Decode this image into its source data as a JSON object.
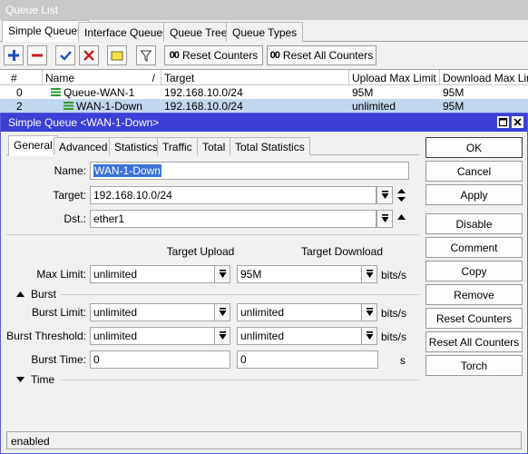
{
  "window": {
    "title": "Queue List"
  },
  "tabs": [
    "Simple Queues",
    "Interface Queues",
    "Queue Tree",
    "Queue Types"
  ],
  "toolbar": {
    "reset_counters": "Reset Counters",
    "reset_all_counters": "Reset All Counters"
  },
  "grid": {
    "headers": [
      "#",
      "Name",
      "Target",
      "Upload Max Limit",
      "Download Max Limit"
    ],
    "rows": [
      {
        "num": "0",
        "name": "Queue-WAN-1",
        "target": "192.168.10.0/24",
        "upload": "95M",
        "download": "95M"
      },
      {
        "num": "2",
        "name": "WAN-1-Down",
        "target": "192.168.10.0/24",
        "upload": "unlimited",
        "download": "95M"
      }
    ]
  },
  "dialog": {
    "title": "Simple Queue <WAN-1-Down>",
    "tabs": [
      "General",
      "Advanced",
      "Statistics",
      "Traffic",
      "Total",
      "Total Statistics"
    ],
    "labels": {
      "name": "Name:",
      "target": "Target:",
      "dst": "Dst.:",
      "target_upload": "Target Upload",
      "target_download": "Target Download",
      "max_limit": "Max Limit:",
      "burst": "Burst",
      "burst_limit": "Burst Limit:",
      "burst_threshold": "Burst Threshold:",
      "burst_time": "Burst Time:",
      "time": "Time"
    },
    "values": {
      "name": "WAN-1-Down",
      "target": "192.168.10.0/24",
      "dst": "ether1",
      "max_up": "unlimited",
      "max_down": "95M",
      "burst_limit_up": "unlimited",
      "burst_limit_down": "unlimited",
      "burst_thr_up": "unlimited",
      "burst_thr_down": "unlimited",
      "burst_time_up": "0",
      "burst_time_down": "0"
    },
    "units": {
      "bits": "bits/s",
      "s": "s"
    },
    "buttons": [
      "OK",
      "Cancel",
      "Apply",
      "Disable",
      "Comment",
      "Copy",
      "Remove",
      "Reset Counters",
      "Reset All Counters",
      "Torch"
    ],
    "status": "enabled"
  }
}
